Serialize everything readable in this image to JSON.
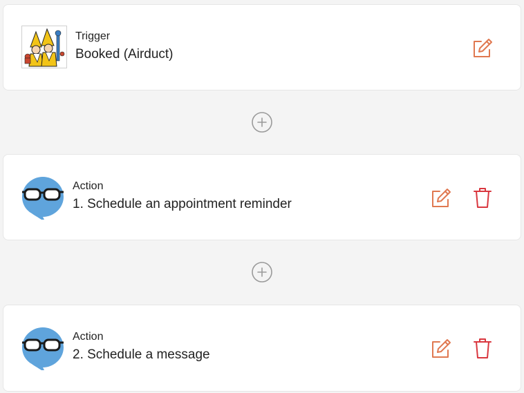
{
  "colors": {
    "page_bg": "#f4f4f4",
    "edit_icon": "#e07850",
    "delete_icon": "#d9363e",
    "avatar_blue": "#5fa4dc",
    "add_circle": "#9a9a9a"
  },
  "trigger": {
    "heading": "Trigger",
    "title": "Booked (Airduct)",
    "edit_icon": "edit-icon"
  },
  "actions": [
    {
      "heading": "Action",
      "title": "1. Schedule an appointment reminder",
      "edit_icon": "edit-icon",
      "delete_icon": "trash-icon"
    },
    {
      "heading": "Action",
      "title": "2. Schedule a message",
      "edit_icon": "edit-icon",
      "delete_icon": "trash-icon"
    }
  ],
  "add_step_icon": "plus-circle-icon"
}
